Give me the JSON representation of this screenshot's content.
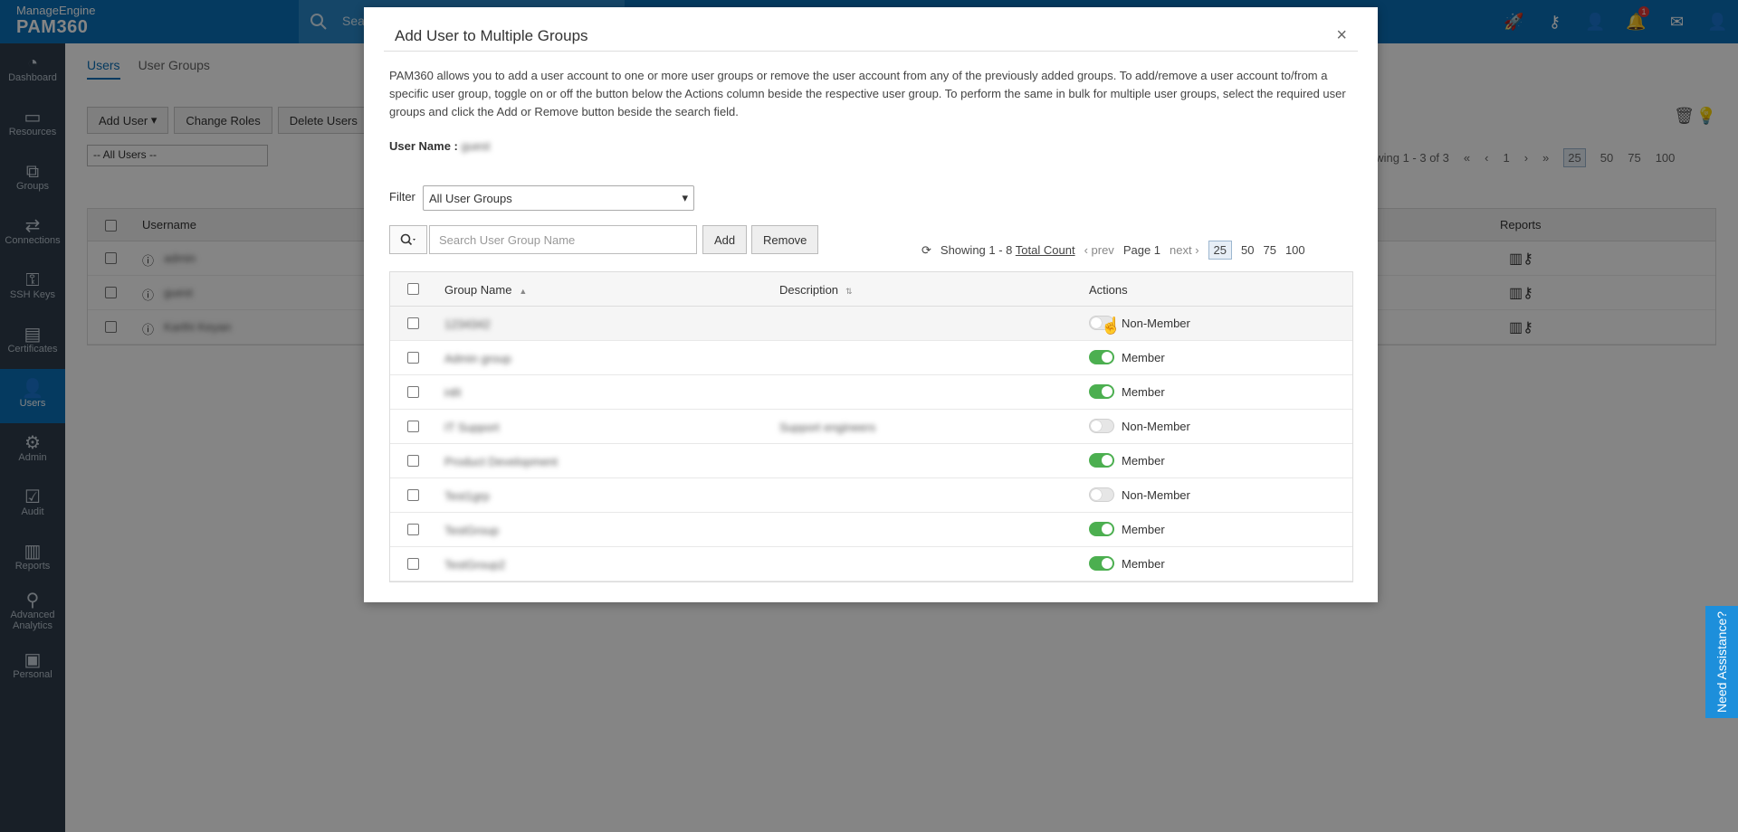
{
  "brand": {
    "vendor": "ManageEngine",
    "product": "PAM360"
  },
  "topbar": {
    "search_placeholder": "Sea",
    "notification_count": "1"
  },
  "nav": [
    {
      "label": "Dashboard",
      "icon": "dashboard-icon"
    },
    {
      "label": "Resources",
      "icon": "resources-icon"
    },
    {
      "label": "Groups",
      "icon": "groups-icon"
    },
    {
      "label": "Connections",
      "icon": "connections-icon"
    },
    {
      "label": "SSH Keys",
      "icon": "ssh-keys-icon"
    },
    {
      "label": "Certificates",
      "icon": "certificates-icon"
    },
    {
      "label": "Users",
      "icon": "users-icon",
      "active": true
    },
    {
      "label": "Admin",
      "icon": "admin-icon"
    },
    {
      "label": "Audit",
      "icon": "audit-icon"
    },
    {
      "label": "Reports",
      "icon": "reports-icon"
    },
    {
      "label": "Advanced Analytics",
      "icon": "analytics-icon"
    },
    {
      "label": "Personal",
      "icon": "personal-icon"
    }
  ],
  "background": {
    "tabs": [
      "Users",
      "User Groups"
    ],
    "toolbar": [
      "Add User",
      "Change Roles",
      "Delete Users"
    ],
    "filter": "-- All Users --",
    "paging": {
      "text": "owing 1 - 3 of 3",
      "page": "1",
      "sizes": [
        "25",
        "50",
        "75",
        "100"
      ]
    },
    "columns": {
      "username": "Username",
      "reports": "Reports"
    },
    "users": [
      "admin",
      "guest",
      "Karthi Keyan"
    ]
  },
  "modal": {
    "title": "Add User to Multiple Groups",
    "close": "×",
    "description": "PAM360 allows you to add a user account to one or more user groups or remove the user account from any of the previously added groups. To add/remove a user account to/from a specific user group, toggle on or off the button below the Actions column beside the respective user group. To perform the same in bulk for multiple user groups, select the required user groups and click the Add or Remove button beside the search field.",
    "user_name_label": "User Name :",
    "user_name_value": "guest",
    "filter_label": "Filter",
    "filter_value": "All User Groups",
    "search_placeholder": "Search User Group Name",
    "add_label": "Add",
    "remove_label": "Remove",
    "pager": {
      "showing": "Showing 1 - 8",
      "total": "Total Count",
      "prev": "prev",
      "page": "Page 1",
      "next": "next",
      "sizes": [
        "25",
        "50",
        "75",
        "100"
      ],
      "selected_size": "25"
    },
    "columns": {
      "group_name": "Group Name",
      "description": "Description",
      "actions": "Actions"
    },
    "rows": [
      {
        "name": "1234342",
        "description": "",
        "member": false,
        "status": "Non-Member"
      },
      {
        "name": "Admin group",
        "description": "",
        "member": true,
        "status": "Member"
      },
      {
        "name": "HR",
        "description": "",
        "member": true,
        "status": "Member"
      },
      {
        "name": "IT Support",
        "description": "Support engineers",
        "member": false,
        "status": "Non-Member"
      },
      {
        "name": "Product Development",
        "description": "",
        "member": true,
        "status": "Member"
      },
      {
        "name": "Test1grp",
        "description": "",
        "member": false,
        "status": "Non-Member"
      },
      {
        "name": "TestGroup",
        "description": "",
        "member": true,
        "status": "Member"
      },
      {
        "name": "TestGroup2",
        "description": "",
        "member": true,
        "status": "Member"
      }
    ]
  },
  "assist_label": "Need Assistance?",
  "colors": {
    "brand_blue": "#0b6fb8",
    "nav_bg": "#2e3d4b",
    "toggle_on": "#4caf50"
  }
}
